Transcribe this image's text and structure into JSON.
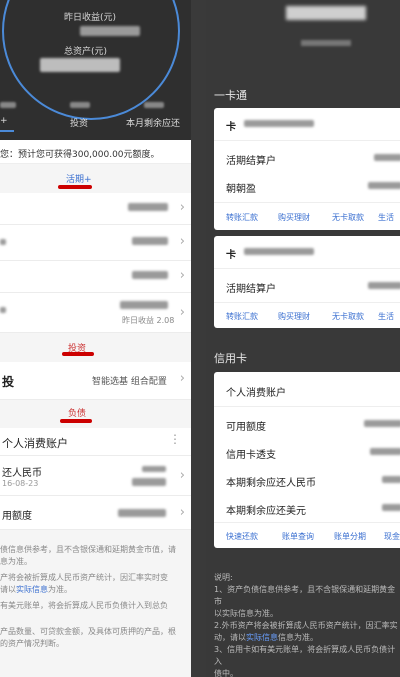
{
  "left": {
    "hero": {
      "label1": "昨日收益(元)",
      "label2": "总资产(元)",
      "tab_investment": "投资",
      "tab_repay": "本月剩余应还"
    },
    "tip": "您：预计您可获得300,000.00元额度。",
    "sections": {
      "current": "活期+",
      "investment": "投资",
      "debt": "负债"
    },
    "current_rows": [
      {
        "sub": ""
      },
      {
        "sub": ""
      },
      {
        "sub": ""
      },
      {
        "sub": "昨日收益 2.08"
      }
    ],
    "investment_row": {
      "label": "投",
      "right_text": "智能选基 组合配置"
    },
    "debt_card": {
      "title": "个人消费账户",
      "row1_label": "还人民币",
      "row1_date": "16-08-23",
      "row2_label": "用额度"
    },
    "notes": [
      "债信息供参考，且不含银保通和延期黄金市值，请",
      "息为准。",
      "产将会被折算成人民币资产统计，因汇率实时变",
      "请以实际信息为准。",
      "有美元账单，将会折算成人民币负债计入到总负",
      "产品数量、可贷款金额，及具体可质押的产品，根",
      "的资产情况判断。"
    ],
    "notes_link": "实际信息"
  },
  "right": {
    "section_yikatong": "一卡通",
    "card1": {
      "account_type": "活期结算户",
      "product": "朝朝盈",
      "links": [
        "转账汇款",
        "购买理财",
        "无卡取款",
        "生活"
      ]
    },
    "card2": {
      "account_type": "活期结算户",
      "links": [
        "转账汇款",
        "购买理财",
        "无卡取款",
        "生活"
      ]
    },
    "section_credit": "信用卡",
    "credit": {
      "title": "个人消费账户",
      "available": "可用额度",
      "overdraft": "信用卡透支",
      "remaining_rmb": "本期剩余应还人民币",
      "remaining_usd": "本期剩余应还美元",
      "links": [
        "快速还款",
        "账单查询",
        "账单分期",
        "现金"
      ]
    },
    "notes_title": "说明:",
    "notes": [
      "1、资产负债信息供参考，且不含银保通和延期黄金市",
      "以实际信息为准。",
      "2.外币资产将会被折算成人民币资产统计，因汇率实",
      "动，请以",
      "信息为准。",
      "3、信用卡如有美元账单，将会折算成人民币负债计入",
      "债中。"
    ],
    "notes_link": "实际信息"
  },
  "colors": {
    "accent_blue": "#3a6fd0",
    "red": "#cc1111",
    "dark_bg": "#393939"
  }
}
